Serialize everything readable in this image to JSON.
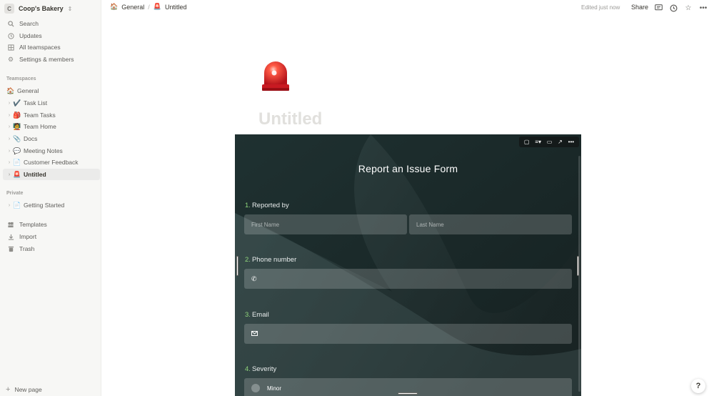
{
  "workspace": {
    "badge": "C",
    "name": "Coop's Bakery"
  },
  "sidebar": {
    "top_items": [
      {
        "label": "Search",
        "icon": "search-icon"
      },
      {
        "label": "Updates",
        "icon": "clock-icon"
      },
      {
        "label": "All teamspaces",
        "icon": "grid-icon"
      },
      {
        "label": "Settings & members",
        "icon": "gear-icon"
      }
    ],
    "teamspaces_title": "Teamspaces",
    "teamspaces": [
      {
        "label": "General",
        "emoji": "🏠"
      },
      {
        "label": "Task List",
        "emoji": "✔️"
      },
      {
        "label": "Team Tasks",
        "emoji": "🎒"
      },
      {
        "label": "Team Home",
        "emoji": "🧑‍🏫"
      },
      {
        "label": "Docs",
        "emoji": "📎"
      },
      {
        "label": "Meeting Notes",
        "emoji": "💬"
      },
      {
        "label": "Customer Feedback",
        "emoji": "📄"
      },
      {
        "label": "Untitled",
        "emoji": "🚨"
      }
    ],
    "private_title": "Private",
    "private": [
      {
        "label": "Getting Started",
        "emoji": "📄"
      }
    ],
    "bottom_items": [
      {
        "label": "Templates",
        "icon": "templates-icon"
      },
      {
        "label": "Import",
        "icon": "import-icon"
      },
      {
        "label": "Trash",
        "icon": "trash-icon"
      }
    ],
    "new_page": "New page"
  },
  "topbar": {
    "crumb_1": "General",
    "crumb_sep": "/",
    "crumb_2": "Untitled",
    "edited": "Edited just now",
    "share": "Share"
  },
  "page": {
    "icon": "🚨",
    "title": "Untitled"
  },
  "form": {
    "title": "Report an Issue Form",
    "questions": [
      {
        "num": "1.",
        "label": "Reported by"
      },
      {
        "num": "2.",
        "label": "Phone number"
      },
      {
        "num": "3.",
        "label": "Email"
      },
      {
        "num": "4.",
        "label": "Severity"
      }
    ],
    "first_name_placeholder": "First Name",
    "last_name_placeholder": "Last Name",
    "severity_option": "Minor"
  },
  "help": "?",
  "colors": {
    "sidebar_bg": "#f7f7f5",
    "form_bg": "#1d2b2b",
    "accent_num": "#8fd47a"
  }
}
